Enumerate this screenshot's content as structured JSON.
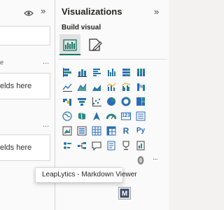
{
  "left_pane": {
    "field_wells": [
      {
        "title": "e",
        "placeholder": "elds here"
      },
      {
        "title": "",
        "placeholder": "elds here"
      }
    ],
    "more_label": "..."
  },
  "viz_pane": {
    "title": "Visualizations",
    "collapse_glyph": "»",
    "build_label": "Build visual",
    "tabs": [
      {
        "icon": "build-visual-icon",
        "selected": true
      },
      {
        "icon": "format-visual-icon",
        "selected": false
      }
    ],
    "visuals": [
      {
        "icon": "stacked-bar-chart-icon"
      },
      {
        "icon": "stacked-column-chart-icon"
      },
      {
        "icon": "clustered-bar-chart-icon"
      },
      {
        "icon": "clustered-column-chart-icon"
      },
      {
        "icon": "100-stacked-bar-chart-icon"
      },
      {
        "icon": "100-stacked-column-chart-icon"
      },
      {
        "icon": "line-chart-icon"
      },
      {
        "icon": "area-chart-icon"
      },
      {
        "icon": "stacked-area-chart-icon"
      },
      {
        "icon": "line-and-stacked-column-chart-icon"
      },
      {
        "icon": "line-and-clustered-column-chart-icon"
      },
      {
        "icon": "ribbon-chart-icon"
      },
      {
        "icon": "waterfall-chart-icon"
      },
      {
        "icon": "funnel-chart-icon"
      },
      {
        "icon": "scatter-chart-icon"
      },
      {
        "icon": "pie-chart-icon"
      },
      {
        "icon": "donut-chart-icon"
      },
      {
        "icon": "treemap-icon"
      },
      {
        "icon": "map-icon"
      },
      {
        "icon": "filled-map-icon"
      },
      {
        "icon": "azure-map-icon"
      },
      {
        "icon": "gauge-icon"
      },
      {
        "icon": "card-icon",
        "text": "123"
      },
      {
        "icon": "multi-row-card-icon"
      },
      {
        "icon": "kpi-icon"
      },
      {
        "icon": "slicer-icon"
      },
      {
        "icon": "table-icon"
      },
      {
        "icon": "matrix-icon"
      },
      {
        "icon": "r-script-visual-icon",
        "text": "R"
      },
      {
        "icon": "python-visual-icon",
        "text": "Py"
      },
      {
        "icon": "key-influencers-icon"
      },
      {
        "icon": "decomposition-tree-icon"
      },
      {
        "icon": "q-and-a-icon"
      },
      {
        "icon": "smart-narrative-icon"
      },
      {
        "icon": "goals-icon"
      },
      {
        "icon": "paginated-report-icon"
      },
      {
        "icon": "power-apps-icon"
      },
      {
        "icon": "more-visuals-icon",
        "text": "···"
      }
    ],
    "custom_visual": {
      "icon": "markdown-viewer-icon",
      "letter": "M"
    }
  },
  "tooltip": {
    "text": "LeapLytics - Markdown Viewer"
  },
  "colors": {
    "accent": "#117865",
    "chart_blue": "#2b6cb8",
    "chart_teal": "#2a8a82",
    "chart_yellow": "#e2b320",
    "pane_background": "#fafafa"
  }
}
